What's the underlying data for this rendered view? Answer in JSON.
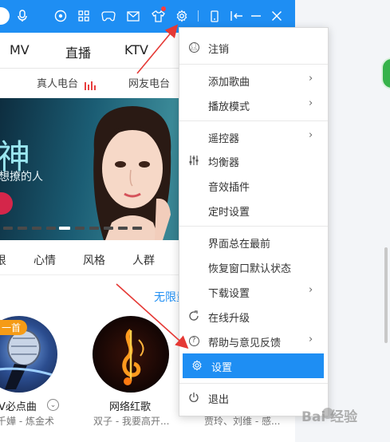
{
  "nav": {
    "tabs": [
      "MV",
      "直播",
      "KTV"
    ]
  },
  "radio": {
    "items": [
      "真人电台",
      "网友电台"
    ]
  },
  "banner": {
    "title": "神",
    "subtitle": "想撩的人"
  },
  "categories": [
    "哏",
    "心情",
    "风格",
    "人群"
  ],
  "section": {
    "more_link": "无限量"
  },
  "cards": [
    {
      "badge": "一首",
      "title": "V必点曲",
      "subtitle": "千嬅 - 炼金术"
    },
    {
      "title": "网络红歌",
      "subtitle": "双子 - 我要高开..."
    },
    {
      "subtitle": "贾玲、刘维 - 感..."
    }
  ],
  "menu": {
    "items": [
      {
        "label": "注销",
        "icon": "user-icon"
      },
      {
        "label": "添加歌曲",
        "has_submenu": true
      },
      {
        "label": "播放模式",
        "has_submenu": true
      },
      {
        "label": "遥控器",
        "has_submenu": true
      },
      {
        "label": "均衡器",
        "icon": "equalizer-icon"
      },
      {
        "label": "音效插件"
      },
      {
        "label": "定时设置"
      },
      {
        "label": "界面总在最前"
      },
      {
        "label": "恢复窗口默认状态"
      },
      {
        "label": "下载设置",
        "has_submenu": true
      },
      {
        "label": "在线升级",
        "icon": "upgrade-icon"
      },
      {
        "label": "帮助与意见反馈",
        "icon": "help-icon",
        "has_submenu": true
      },
      {
        "label": "设置",
        "icon": "gear-icon",
        "highlighted": true
      },
      {
        "label": "退出",
        "icon": "power-icon"
      }
    ]
  },
  "watermark": {
    "text": "Bai  经验"
  },
  "colors": {
    "accent": "#1e8ef3",
    "annotation_arrow": "#e53935",
    "badge": "#f59b16"
  }
}
